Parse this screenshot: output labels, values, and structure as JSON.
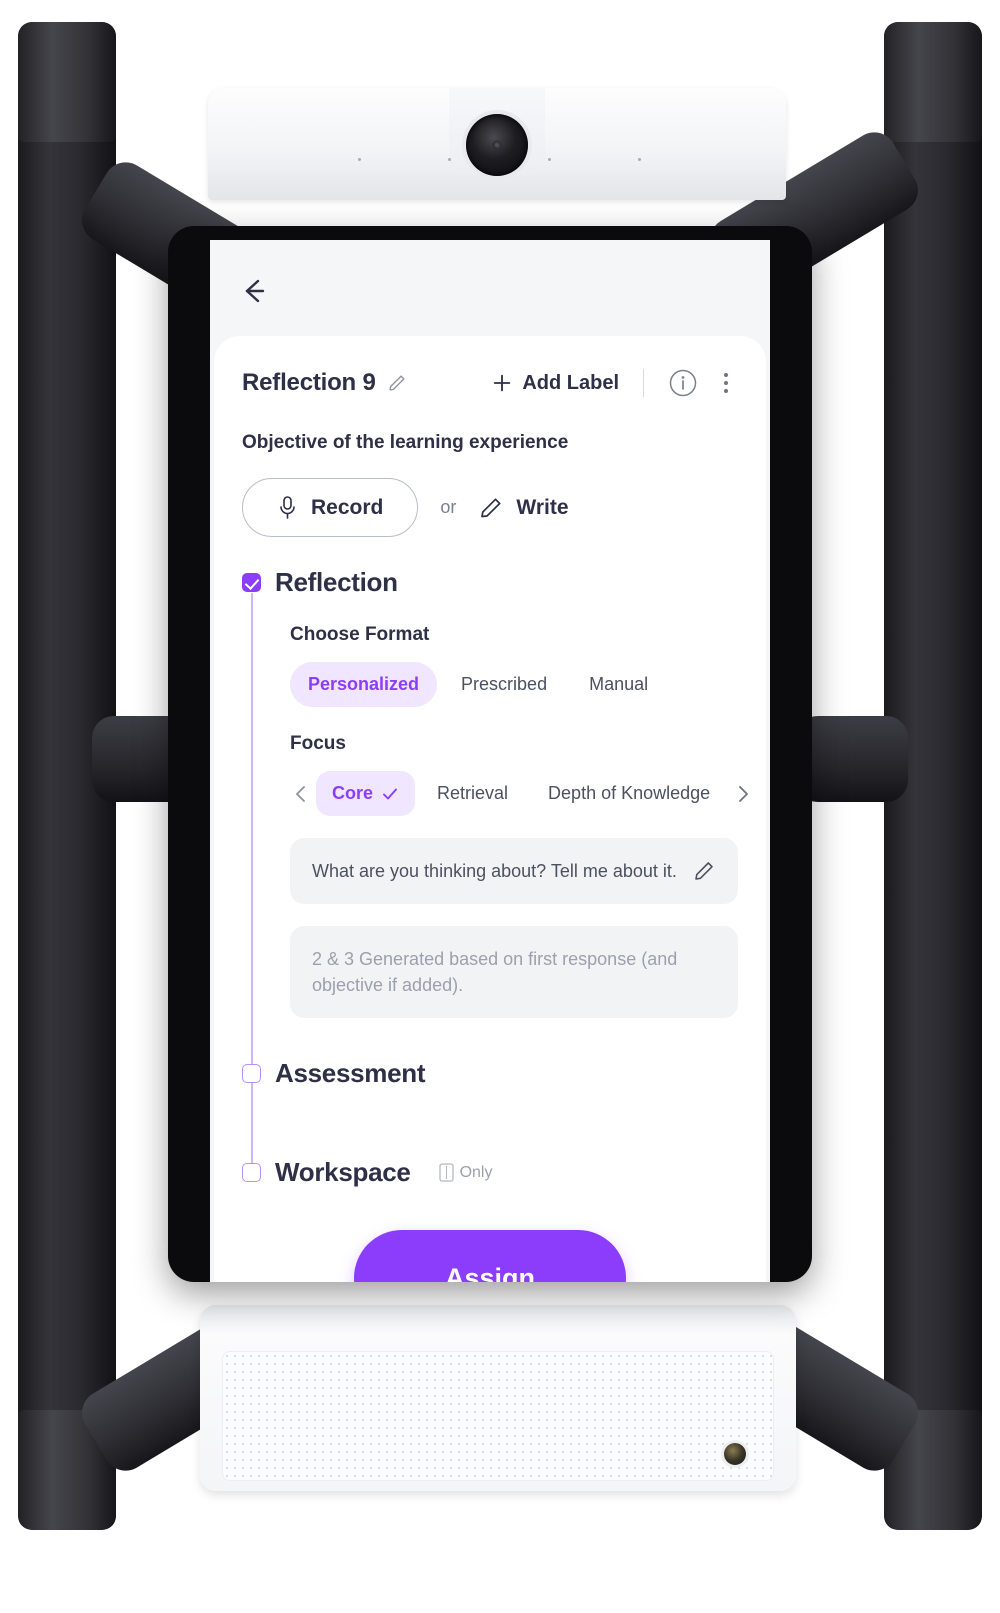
{
  "device": {
    "camera_icon": "camera-lens",
    "speaker_icon": "speaker-grille",
    "port_icon": "power-port"
  },
  "screen": {
    "back_icon": "back-arrow-icon",
    "card": {
      "title": "Reflection 9",
      "title_edit_icon": "pencil-icon",
      "add_label": "Add Label",
      "add_label_icon": "plus-icon",
      "info_icon": "info-circle-icon",
      "more_icon": "kebab-menu-icon",
      "objective_label": "Objective of the learning experience",
      "record_label": "Record",
      "record_icon": "microphone-icon",
      "or_label": "or",
      "write_label": "Write",
      "write_icon": "pencil-icon",
      "sections": [
        {
          "name": "Reflection",
          "checked": true,
          "format_label": "Choose Format",
          "format_options": [
            "Personalized",
            "Prescribed",
            "Manual"
          ],
          "format_selected": "Personalized",
          "focus_label": "Focus",
          "focus_prev_icon": "chevron-left-icon",
          "focus_next_icon": "chevron-right-icon",
          "focus_options": [
            "Core",
            "Retrieval",
            "Depth of Knowledge"
          ],
          "focus_selected": "Core",
          "focus_selected_icon": "check-icon",
          "prompt_1": "What are you thinking about? Tell me about it.",
          "prompt_1_edit_icon": "pencil-icon",
          "prompt_2": "2 & 3 Generated based on first response (and objective if added)."
        },
        {
          "name": "Assessment",
          "checked": false
        },
        {
          "name": "Workspace",
          "checked": false,
          "badge_icon": "tablet-icon",
          "badge_text": "Only"
        }
      ],
      "assign_label": "Assign"
    }
  },
  "colors": {
    "accent": "#8b3dfb",
    "accent_soft": "#f1e6ff",
    "timeline": "#cdb6fb",
    "text": "#2d3047",
    "muted": "#9aa0ad",
    "field_bg": "#f2f3f5",
    "screen_bg": "#f5f6f8"
  }
}
